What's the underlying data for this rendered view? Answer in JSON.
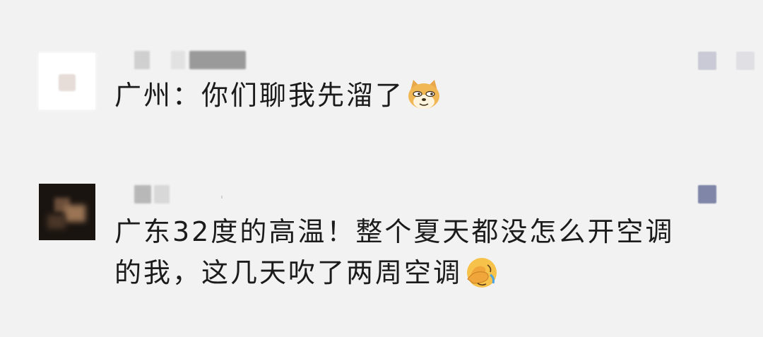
{
  "comments": [
    {
      "text": "广州：你们聊我先溜了",
      "emoji": "doge-cat-icon"
    },
    {
      "line1": "广东32度的高温！整个夏天都没怎么开空调",
      "line2": "的我，这几天吹了两周空调",
      "emoji": "facepalm-crying-icon"
    }
  ],
  "colors": {
    "background": "#f2f2f2",
    "text": "#1b1b1b",
    "badge": "#7f86a8"
  }
}
